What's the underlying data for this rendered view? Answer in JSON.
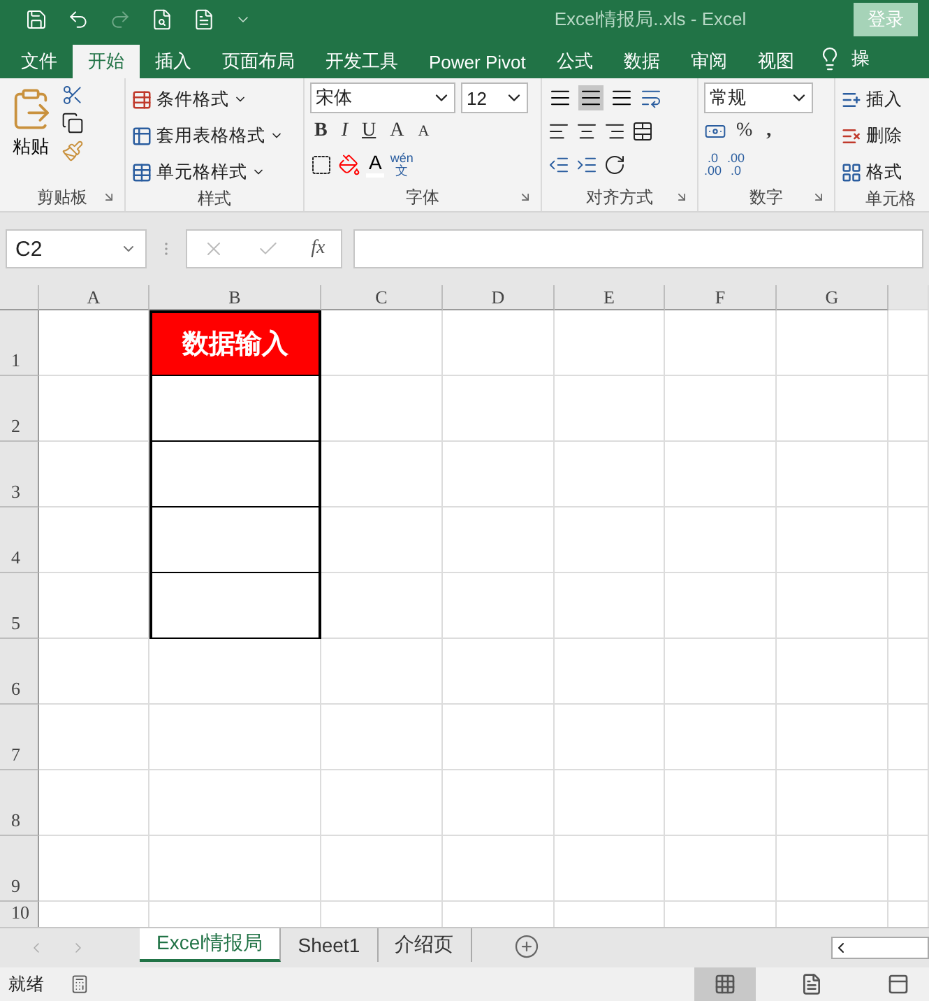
{
  "window": {
    "title": "Excel情报局..xls  -  Excel",
    "sign_in": "登录"
  },
  "ribbon_tabs": [
    {
      "label": "文件",
      "selected": false
    },
    {
      "label": "开始",
      "selected": true
    },
    {
      "label": "插入",
      "selected": false
    },
    {
      "label": "页面布局",
      "selected": false
    },
    {
      "label": "开发工具",
      "selected": false
    },
    {
      "label": "Power Pivot",
      "selected": false
    },
    {
      "label": "公式",
      "selected": false
    },
    {
      "label": "数据",
      "selected": false
    },
    {
      "label": "审阅",
      "selected": false
    },
    {
      "label": "视图",
      "selected": false
    }
  ],
  "tell_me": "操",
  "ribbon_groups": [
    {
      "kind": "clipboard",
      "label": "剪贴板",
      "launcher": true,
      "paste": "粘贴"
    },
    {
      "kind": "styles",
      "label": "样式",
      "launcher": false,
      "commands": [
        "条件格式",
        "套用表格格式",
        "单元格样式"
      ]
    },
    {
      "kind": "font",
      "label": "字体",
      "launcher": true,
      "font_name": "宋体",
      "font_size": "12",
      "buttons": [
        "B",
        "I",
        "U"
      ],
      "grow": "A",
      "shrink": "A",
      "font_color_label": "A",
      "phonetic_top": "wén",
      "phonetic_bottom": "文"
    },
    {
      "kind": "alignment",
      "label": "对齐方式",
      "launcher": true,
      "vertical": [
        {
          "selected": false
        },
        {
          "selected": true
        },
        {
          "selected": false
        }
      ]
    },
    {
      "kind": "number",
      "label": "数字",
      "launcher": true,
      "format": "常规",
      "percent": "%",
      "comma": ",",
      "increase_decimal": [
        ".0",
        ".00"
      ],
      "decrease_decimal": [
        ".00",
        ".0"
      ]
    },
    {
      "kind": "cells",
      "label": "单元格",
      "launcher": false,
      "commands": [
        "插入",
        "删除",
        "格式"
      ]
    }
  ],
  "formula_bar": {
    "name_box": "C2",
    "function_label": "fx"
  },
  "sheet": {
    "columns": [
      "A",
      "B",
      "C",
      "D",
      "E",
      "F",
      "G"
    ],
    "rows": [
      {
        "label": "1",
        "cells": [
          {
            "kind": "blank"
          },
          {
            "kind": "header",
            "text": "数据输入"
          },
          {
            "kind": "blank"
          },
          {
            "kind": "blank"
          },
          {
            "kind": "blank"
          },
          {
            "kind": "blank"
          },
          {
            "kind": "blank"
          }
        ]
      },
      {
        "label": "2",
        "cells": [
          {
            "kind": "blank"
          },
          {
            "kind": "input"
          },
          {
            "kind": "blank"
          },
          {
            "kind": "blank"
          },
          {
            "kind": "blank"
          },
          {
            "kind": "blank"
          },
          {
            "kind": "blank"
          }
        ]
      },
      {
        "label": "3",
        "cells": [
          {
            "kind": "blank"
          },
          {
            "kind": "input"
          },
          {
            "kind": "blank"
          },
          {
            "kind": "blank"
          },
          {
            "kind": "blank"
          },
          {
            "kind": "blank"
          },
          {
            "kind": "blank"
          }
        ]
      },
      {
        "label": "4",
        "cells": [
          {
            "kind": "blank"
          },
          {
            "kind": "input"
          },
          {
            "kind": "blank"
          },
          {
            "kind": "blank"
          },
          {
            "kind": "blank"
          },
          {
            "kind": "blank"
          },
          {
            "kind": "blank"
          }
        ]
      },
      {
        "label": "5",
        "cells": [
          {
            "kind": "blank"
          },
          {
            "kind": "input"
          },
          {
            "kind": "blank"
          },
          {
            "kind": "blank"
          },
          {
            "kind": "blank"
          },
          {
            "kind": "blank"
          },
          {
            "kind": "blank"
          }
        ]
      },
      {
        "label": "6",
        "cells": [
          {
            "kind": "blank"
          },
          {
            "kind": "blank"
          },
          {
            "kind": "blank"
          },
          {
            "kind": "blank"
          },
          {
            "kind": "blank"
          },
          {
            "kind": "blank"
          },
          {
            "kind": "blank"
          }
        ]
      },
      {
        "label": "7",
        "cells": [
          {
            "kind": "blank"
          },
          {
            "kind": "blank"
          },
          {
            "kind": "blank"
          },
          {
            "kind": "blank"
          },
          {
            "kind": "blank"
          },
          {
            "kind": "blank"
          },
          {
            "kind": "blank"
          }
        ]
      },
      {
        "label": "8",
        "cells": [
          {
            "kind": "blank"
          },
          {
            "kind": "blank"
          },
          {
            "kind": "blank"
          },
          {
            "kind": "blank"
          },
          {
            "kind": "blank"
          },
          {
            "kind": "blank"
          },
          {
            "kind": "blank"
          }
        ]
      },
      {
        "label": "9",
        "cells": [
          {
            "kind": "blank"
          },
          {
            "kind": "blank"
          },
          {
            "kind": "blank"
          },
          {
            "kind": "blank"
          },
          {
            "kind": "blank"
          },
          {
            "kind": "blank"
          },
          {
            "kind": "blank"
          }
        ]
      },
      {
        "label": "10",
        "cells": [
          {
            "kind": "blank"
          },
          {
            "kind": "blank"
          },
          {
            "kind": "blank"
          },
          {
            "kind": "blank"
          },
          {
            "kind": "blank"
          },
          {
            "kind": "blank"
          },
          {
            "kind": "blank"
          }
        ]
      }
    ]
  },
  "sheet_tabs": [
    {
      "label": "Excel情报局",
      "selected": true
    },
    {
      "label": "Sheet1",
      "selected": false
    },
    {
      "label": "介绍页",
      "selected": false
    }
  ],
  "status_bar": {
    "text": "就绪",
    "views": [
      {
        "selected": true
      },
      {
        "selected": false
      },
      {
        "selected": false
      }
    ]
  }
}
